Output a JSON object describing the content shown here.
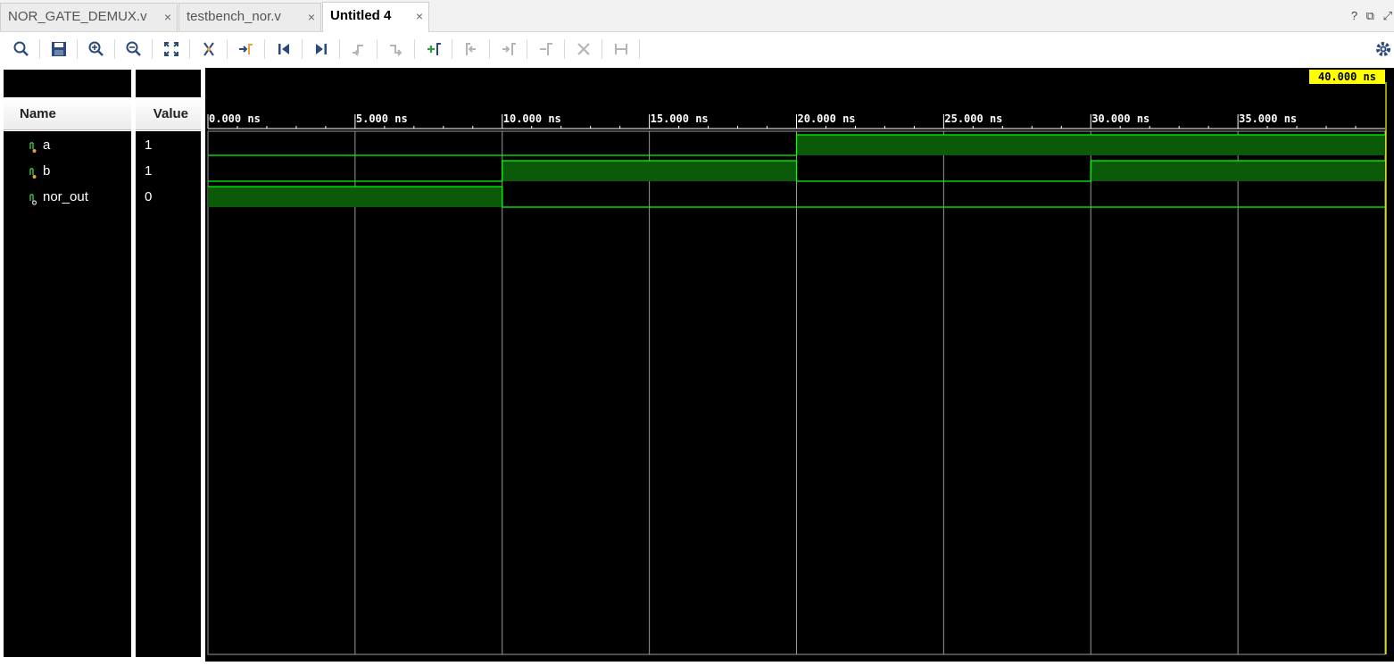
{
  "tabs": [
    {
      "label": "NOR_GATE_DEMUX.v",
      "active": false
    },
    {
      "label": "testbench_nor.v",
      "active": false
    },
    {
      "label": "Untitled 4",
      "active": true
    }
  ],
  "tab_close_glyph": "×",
  "window_icons": [
    "?",
    "⧉",
    "⤢"
  ],
  "toolbar_icons": [
    "search-icon",
    "save-icon",
    "zoom-in-icon",
    "zoom-out-icon",
    "zoom-fit-icon",
    "cursor-snap-icon",
    "go-to-cursor-icon",
    "go-to-start-icon",
    "go-to-end-icon",
    "previous-transition-icon",
    "next-transition-icon",
    "add-marker-icon",
    "previous-marker-icon",
    "next-marker-icon",
    "swap-cursors-icon",
    "delete-marker-icon",
    "marker-span-icon",
    "settings-icon"
  ],
  "columns": {
    "name": "Name",
    "value": "Value"
  },
  "signals": [
    {
      "name": "a",
      "value": "1"
    },
    {
      "name": "b",
      "value": "1"
    },
    {
      "name": "nor_out",
      "value": "0"
    }
  ],
  "cursor_time": "40.000 ns",
  "ticks": [
    "0.000 ns",
    "5.000 ns",
    "10.000 ns",
    "15.000 ns",
    "20.000 ns",
    "25.000 ns",
    "30.000 ns",
    "35.000 ns"
  ],
  "waveforms": [
    {
      "signal": "a",
      "transitions": [
        [
          0,
          0
        ],
        [
          20,
          1
        ]
      ]
    },
    {
      "signal": "b",
      "transitions": [
        [
          0,
          0
        ],
        [
          10,
          1
        ],
        [
          20,
          0
        ],
        [
          30,
          1
        ]
      ]
    },
    {
      "signal": "nor_out",
      "transitions": [
        [
          0,
          1
        ],
        [
          10,
          0
        ]
      ]
    }
  ],
  "time_range_ns": [
    0,
    40
  ],
  "colors": {
    "wave": "#00ff00",
    "wave_fill": "#0a5a0a",
    "cursor_bg": "#ffff00",
    "grid": "#9a9a9a"
  }
}
